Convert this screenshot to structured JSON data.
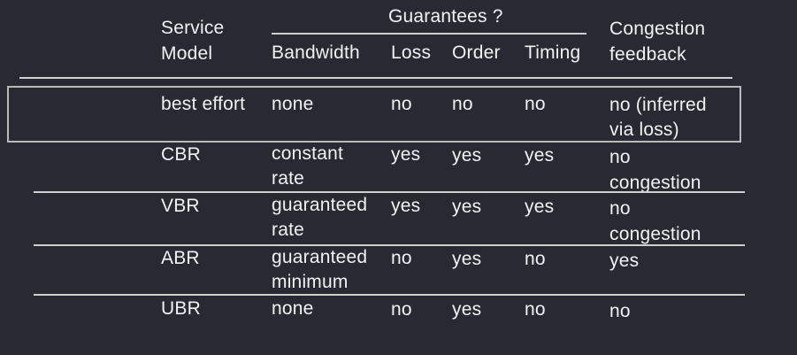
{
  "headers": {
    "service_model": "Service\nModel",
    "guarantees": "Guarantees ?",
    "bandwidth": "Bandwidth",
    "loss": "Loss",
    "order": "Order",
    "timing": "Timing",
    "congestion": "Congestion\nfeedback"
  },
  "rows": [
    {
      "model": "best effort",
      "bandwidth": "none",
      "loss": "no",
      "order": "no",
      "timing": "no",
      "congestion": "no (inferred\nvia loss)"
    },
    {
      "model": "CBR",
      "bandwidth": "constant\nrate",
      "loss": "yes",
      "order": "yes",
      "timing": "yes",
      "congestion": "no\ncongestion"
    },
    {
      "model": "VBR",
      "bandwidth": "guaranteed\nrate",
      "loss": "yes",
      "order": "yes",
      "timing": "yes",
      "congestion": "no\ncongestion"
    },
    {
      "model": "ABR",
      "bandwidth": "guaranteed\nminimum",
      "loss": "no",
      "order": "yes",
      "timing": "no",
      "congestion": "yes"
    },
    {
      "model": "UBR",
      "bandwidth": "none",
      "loss": "no",
      "order": "yes",
      "timing": "no",
      "congestion": "no"
    }
  ],
  "colors": {
    "background": "#282a33",
    "text": "#f2f2f2",
    "rule": "#cfcfcf",
    "highlight": "#b9b9b9"
  }
}
